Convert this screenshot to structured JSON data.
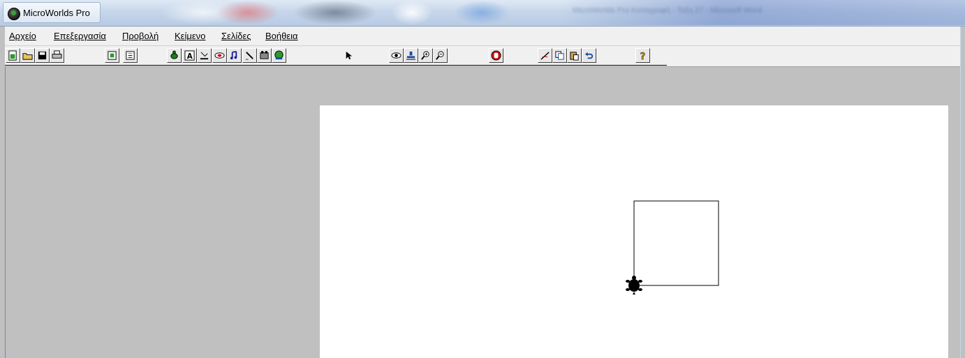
{
  "window": {
    "title": "MicroWorlds Pro",
    "background_title": "MicroWorlds Pro Καταγραφή - Ταξη 27 - Microsoft Word"
  },
  "menu": {
    "items": [
      {
        "label": "Αρχείο"
      },
      {
        "label": "Επεξεργασία"
      },
      {
        "label": "Προβολή"
      },
      {
        "label": "Κείμενο"
      },
      {
        "label": "Σελίδες"
      },
      {
        "label": "Βοήθεια"
      }
    ]
  },
  "toolbar": {
    "buttons": [
      {
        "icon": "new-project-icon"
      },
      {
        "icon": "open-folder-icon"
      },
      {
        "icon": "save-disk-icon"
      },
      {
        "icon": "printer-icon"
      },
      {
        "icon": "full-screen-icon"
      },
      {
        "icon": "project-view-icon"
      },
      {
        "icon": "new-turtle-icon"
      },
      {
        "icon": "text-box-icon"
      },
      {
        "icon": "slider-icon"
      },
      {
        "icon": "button-icon"
      },
      {
        "icon": "music-icon"
      },
      {
        "icon": "pen-icon"
      },
      {
        "icon": "movie-icon"
      },
      {
        "icon": "melody-icon"
      },
      {
        "icon": "pointer-icon"
      },
      {
        "icon": "eye-icon"
      },
      {
        "icon": "stamp-icon"
      },
      {
        "icon": "zoom-in-icon"
      },
      {
        "icon": "zoom-out-icon"
      },
      {
        "icon": "stop-icon"
      },
      {
        "icon": "cut-icon"
      },
      {
        "icon": "copy-icon"
      },
      {
        "icon": "paste-icon"
      },
      {
        "icon": "undo-icon"
      },
      {
        "icon": "help-icon"
      }
    ]
  },
  "canvas": {
    "drawing": "square drawn by turtle",
    "turtle": "turtle-icon"
  },
  "colors": {
    "workspace": "#c0c0c0",
    "page": "#ffffff",
    "stroke": "#000000"
  }
}
